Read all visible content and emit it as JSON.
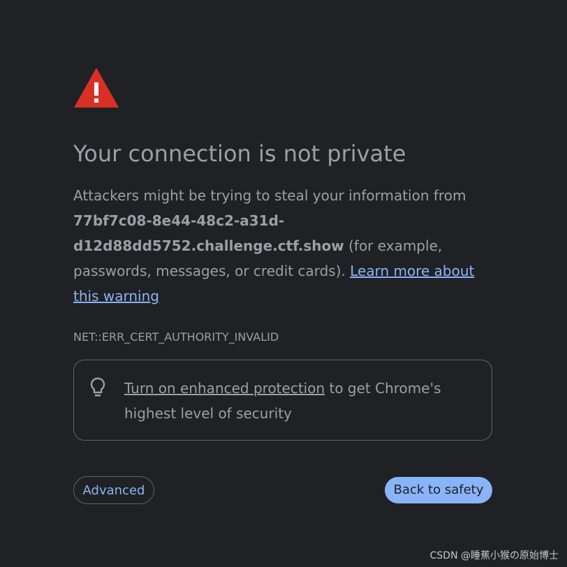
{
  "colors": {
    "background": "#202124",
    "text": "#9aa0a6",
    "link": "#8ab4f8",
    "warning_red": "#d93025",
    "border": "#5f6368"
  },
  "warning": {
    "icon": "warning-triangle-icon",
    "title": "Your connection is not private",
    "message_prefix": "Attackers might be trying to steal your information from ",
    "host": "77bf7c08-8e44-48c2-a31d-d12d88dd5752.challenge.ctf.show",
    "message_suffix": " (for example, passwords, messages, or credit cards). ",
    "learn_more_link": "Learn more about this warning",
    "error_code": "NET::ERR_CERT_AUTHORITY_INVALID"
  },
  "enhanced_protection": {
    "icon": "lightbulb-icon",
    "link_text": "Turn on enhanced protection",
    "suffix_text": " to get Chrome's highest level of security"
  },
  "buttons": {
    "advanced": "Advanced",
    "back_to_safety": "Back to safety"
  },
  "watermark": "CSDN @睡蕉小猴の原始博士"
}
